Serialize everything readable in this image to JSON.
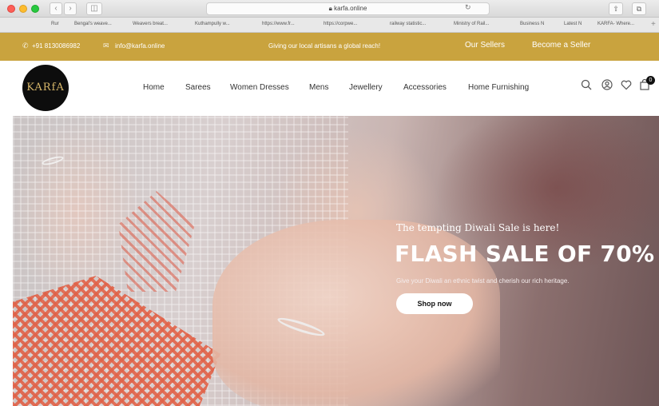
{
  "browser": {
    "address": "karfa.online",
    "bookmarks": [
      "Rur",
      "Bengal's weave...",
      "Weavers breat...",
      "Kuthampully w...",
      "https://www.fr...",
      "https://corpwe...",
      "railway statistic...",
      "Ministry of Rail...",
      "Business N",
      "Latest N",
      "KARFA- Where..."
    ]
  },
  "topbar": {
    "phone": "+91 8130086982",
    "email": "info@karfa.online",
    "tagline": "Giving our local artisans a global reach!",
    "our_sellers": "Our Sellers",
    "become_seller": "Become a Seller"
  },
  "header": {
    "logo_text": "KARfA",
    "nav": [
      "Home",
      "Sarees",
      "Women Dresses",
      "Mens",
      "Jewellery",
      "Accessories",
      "Home Furnishing"
    ],
    "cart_count": "0"
  },
  "hero": {
    "subtitle": "The tempting Diwali Sale is here!",
    "title": "FLASH SALE OF 70%",
    "description": "Give your Diwali an ethnic twist and cherish our rich heritage.",
    "button": "Shop now"
  },
  "colors": {
    "topbar": "#c9a33e",
    "logo_bg": "#0d0d0d",
    "logo_text": "#d7b76a"
  },
  "icons": [
    "search-icon",
    "account-icon",
    "wishlist-heart-icon",
    "cart-bag-icon",
    "phone-icon",
    "mail-icon"
  ]
}
